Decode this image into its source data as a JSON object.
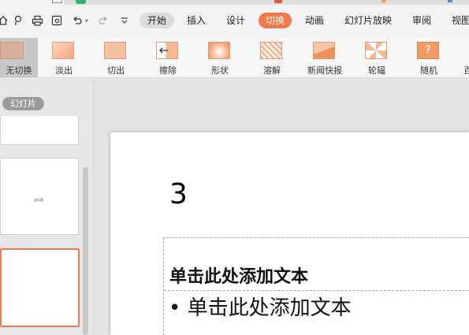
{
  "menu": {
    "tabs": [
      {
        "label": "开始",
        "state": "pill"
      },
      {
        "label": "插入",
        "state": ""
      },
      {
        "label": "设计",
        "state": ""
      },
      {
        "label": "切换",
        "state": "active"
      },
      {
        "label": "动画",
        "state": ""
      },
      {
        "label": "幻灯片放映",
        "state": ""
      },
      {
        "label": "审阅",
        "state": ""
      },
      {
        "label": "视图",
        "state": ""
      }
    ]
  },
  "quick_access": [
    "home-icon",
    "share-icon",
    "print-icon",
    "preview-icon",
    "undo-icon",
    "redo-icon",
    "customize-icon"
  ],
  "transitions": {
    "items": [
      {
        "label": "无切换",
        "icon": "no-transition-icon",
        "selected": true
      },
      {
        "label": "淡出",
        "icon": "fade-icon"
      },
      {
        "label": "切出",
        "icon": "cut-icon"
      },
      {
        "label": "擦除",
        "icon": "wipe-icon"
      },
      {
        "label": "形状",
        "icon": "shape-icon"
      },
      {
        "label": "溶解",
        "icon": "dissolve-icon"
      },
      {
        "label": "新闻快报",
        "icon": "newsflash-icon"
      },
      {
        "label": "轮辐",
        "icon": "wheel-icon"
      },
      {
        "label": "随机",
        "icon": "random-icon",
        "glyph": "?"
      },
      {
        "label": "百",
        "icon": "blinds-icon"
      }
    ]
  },
  "slides_panel": {
    "label": "幻灯片",
    "thumb2_text": "副标题"
  },
  "slide": {
    "title": "3",
    "placeholder_heading": "单击此处添加文本",
    "placeholder_bullet": "• 单击此处添加文本"
  },
  "colors": {
    "accent": "#f07a4c",
    "selection_border": "#f07a4c"
  }
}
